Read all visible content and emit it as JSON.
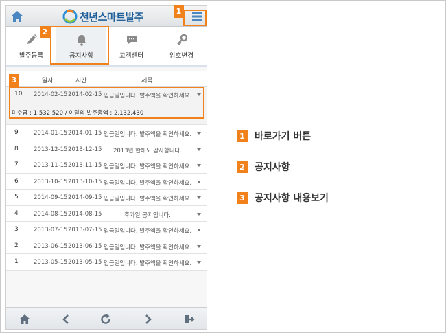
{
  "app": {
    "title": "천년스마트발주"
  },
  "tabs": [
    {
      "label": "발주등록",
      "icon": "pencil-icon"
    },
    {
      "label": "공지사항",
      "icon": "bell-icon",
      "active": true
    },
    {
      "label": "고객센터",
      "icon": "chat-icon"
    },
    {
      "label": "암호변경",
      "icon": "key-icon"
    }
  ],
  "table": {
    "headers": {
      "date": "일자",
      "time": "시간",
      "title": "제목"
    },
    "rows": [
      {
        "no": "10",
        "d1": "2014-02-15",
        "d2": "2014-02-15",
        "title": "입금일입니다. 발주액을 확인하세요.",
        "open": true
      },
      {
        "no": "9",
        "d1": "2014-01-15",
        "d2": "2014-01-15",
        "title": "입금일입니다. 발주액을 확인하세요."
      },
      {
        "no": "8",
        "d1": "2013-12-15",
        "d2": "2013-12-15",
        "title": "2013년 한해도 감사합니다."
      },
      {
        "no": "7",
        "d1": "2013-11-15",
        "d2": "2013-11-15",
        "title": "입금일입니다. 발주액을 확인하세요."
      },
      {
        "no": "6",
        "d1": "2013-10-15",
        "d2": "2013-10-15",
        "title": "입금일입니다. 발주액을 확인하세요."
      },
      {
        "no": "5",
        "d1": "2014-09-15",
        "d2": "2014-09-15",
        "title": "입금일입니다. 발주액을 확인하세요."
      },
      {
        "no": "4",
        "d1": "2014-08-15",
        "d2": "2014-08-15",
        "title": "휴가일 공지입니다."
      },
      {
        "no": "3",
        "d1": "2013-07-15",
        "d2": "2013-07-15",
        "title": "입금일입니다. 발주액을 확인하세요."
      },
      {
        "no": "2",
        "d1": "2013-06-15",
        "d2": "2013-06-15",
        "title": "입금일입니다. 발주액을 확인하세요."
      },
      {
        "no": "1",
        "d1": "2013-05-15",
        "d2": "2013-05-15",
        "title": "입금일입니다. 발주액을 확인하세요."
      }
    ],
    "expanded_detail": "미수금 : 1,532,520   /   이달의 발주총액 : 2,132,430"
  },
  "callouts": {
    "one": "1",
    "two": "2",
    "three": "3"
  },
  "legend": [
    {
      "num": "1",
      "text": "바로가기 버튼"
    },
    {
      "num": "2",
      "text": "공지사항"
    },
    {
      "num": "3",
      "text": "공지사항 내용보기"
    }
  ],
  "colors": {
    "accent": "#f0811b",
    "brand": "#1f5f9a"
  }
}
